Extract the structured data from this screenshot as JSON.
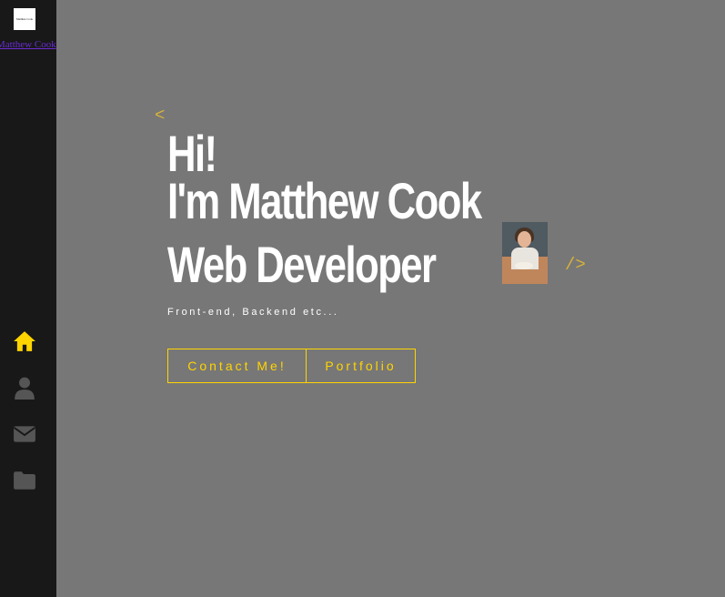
{
  "sidebar": {
    "logo_text": "Matthew Cook",
    "logo_link": "Matthew Cook",
    "nav": [
      {
        "icon": "home-icon",
        "active": true
      },
      {
        "icon": "user-icon",
        "active": false
      },
      {
        "icon": "envelope-icon",
        "active": false
      },
      {
        "icon": "folder-icon",
        "active": false
      }
    ]
  },
  "hero": {
    "tag_open": "<",
    "tag_close": "/>",
    "line1": "Hi!",
    "line2": "I'm Matthew Cook",
    "line3": "Web Developer",
    "subtitle": "Front-end, Backend etc...",
    "buttons": {
      "contact": "Contact Me!",
      "portfolio": "Portfolio"
    }
  },
  "colors": {
    "background": "#777777",
    "sidebar": "#181818",
    "accent": "#ffd400",
    "icon_inactive": "#555555",
    "link": "#6a2bd1"
  }
}
